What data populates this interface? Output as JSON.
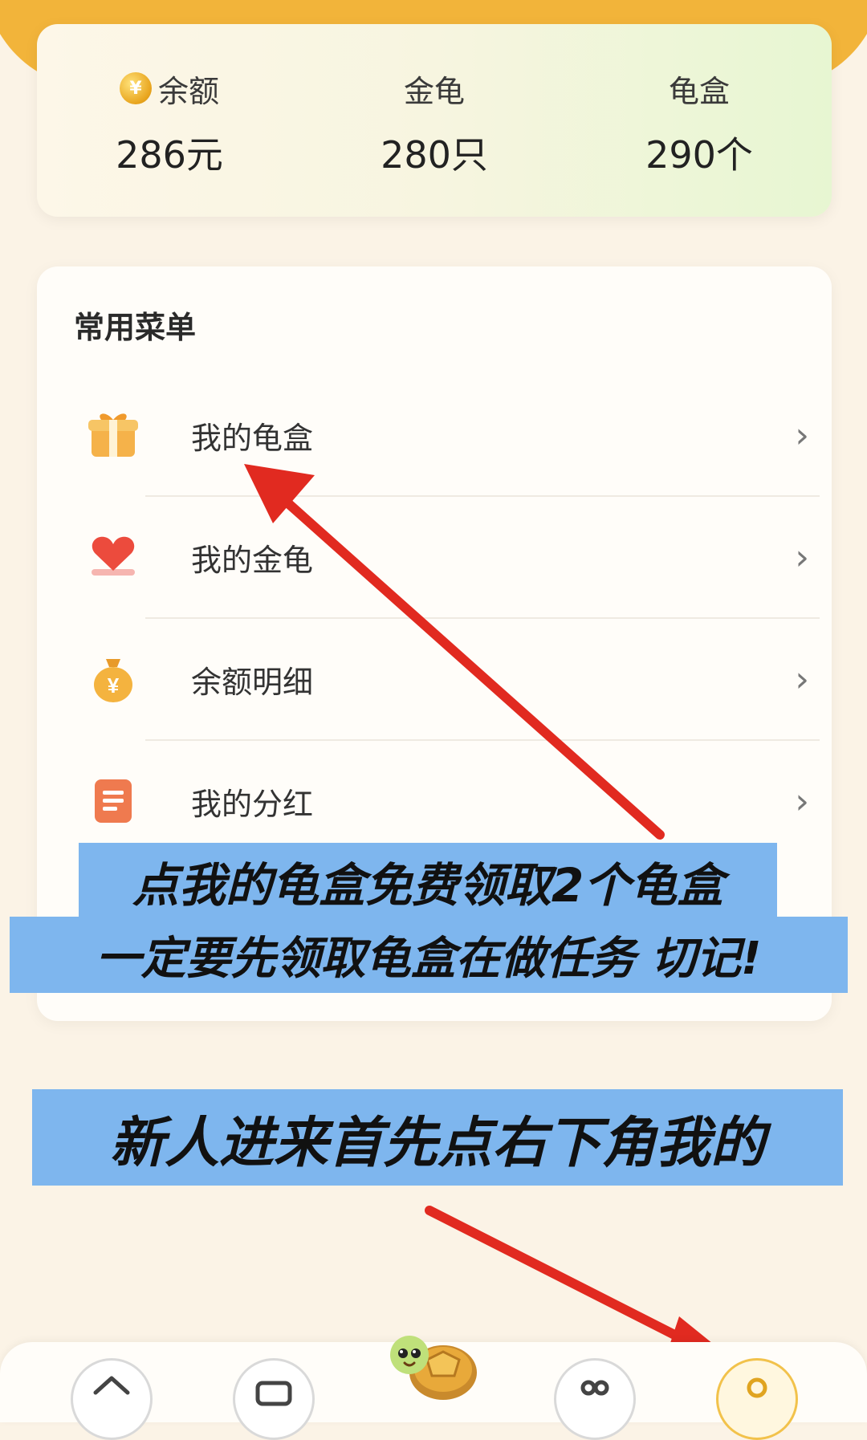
{
  "stats": [
    {
      "label": "余额",
      "value": "286元",
      "icon": "coin-icon"
    },
    {
      "label": "金龟",
      "value": "280只"
    },
    {
      "label": "龟盒",
      "value": "290个"
    }
  ],
  "menu": {
    "title": "常用菜单",
    "items": [
      {
        "label": "我的龟盒",
        "icon": "gift-box-icon"
      },
      {
        "label": "我的金龟",
        "icon": "heart-icon"
      },
      {
        "label": "余额明细",
        "icon": "money-bag-icon"
      },
      {
        "label": "我的分红",
        "icon": "document-icon"
      }
    ]
  },
  "annotations": {
    "line1": "点我的龟盒免费领取2个龟盒",
    "line2": "一定要先领取龟盒在做任务 切记!",
    "line3": "新人进来首先点右下角我的"
  },
  "colors": {
    "accent": "#f2b43a",
    "banner": "#7eb6ee",
    "arrow": "#e12a20"
  }
}
